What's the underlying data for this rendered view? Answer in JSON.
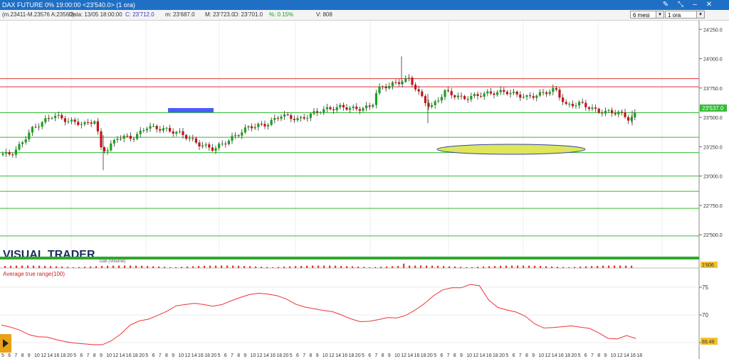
{
  "window": {
    "title": "DAX FUTURE 0% 19:00:00  <23'540.0> (1 ora)",
    "controls": [
      "pin-icon",
      "expand-icon",
      "minimize-icon",
      "close-icon"
    ]
  },
  "infobar": {
    "bidask": "(m.23411-M.23576 A:23560)",
    "data": "Data: 13/05 18:00:00",
    "close": "C: 23'712.0",
    "min": "m: 23'687.0",
    "max": "M: 23'723.0",
    "open": "O: 23'701.0",
    "pct": "%: 0.15%",
    "vol": "V: 808",
    "period": "6 mesi",
    "timeframe": "1 ora"
  },
  "price_axis": {
    "labels": [
      "24'250.0",
      "24'000.0",
      "23'750.0",
      "23'500.0",
      "23'250.0",
      "23'000.0",
      "22'750.0",
      "22'500.0"
    ],
    "current": "23'537.0"
  },
  "logo": "VISUAL TRADER",
  "volume_label": "Dati (Volume)",
  "volume_value": "1'606",
  "atr": {
    "label": "Average true range(100)",
    "labels": [
      "75",
      "70"
    ],
    "current": "65.49"
  },
  "colors": {
    "up": "#1aa31a",
    "down": "#cc1111",
    "support": "#33bb33",
    "resistance": "#dd3333",
    "atr_line": "#ee3333"
  },
  "chart_data": {
    "type": "candlestick",
    "ylim": [
      22350,
      24300
    ],
    "support_levels": [
      23540,
      23330,
      23200,
      23000,
      22870,
      22725,
      22490
    ],
    "resistance_levels": [
      23830,
      23760
    ],
    "atr_ylim": [
      62,
      80
    ],
    "atr_values": [
      67.9,
      67.4,
      66.7,
      65.6,
      65.1,
      65.0,
      64.4,
      63.9,
      63.6,
      63.4,
      63.2,
      63.2,
      64.2,
      65.8,
      67.9,
      68.9,
      69.3,
      70.2,
      71.2,
      72.5,
      72.8,
      73.1,
      72.8,
      72.4,
      72.8,
      73.7,
      74.5,
      75.2,
      75.5,
      75.3,
      74.9,
      74.1,
      72.9,
      72.2,
      71.8,
      71.4,
      71.1,
      70.3,
      69.4,
      68.7,
      68.8,
      69.2,
      69.7,
      69.6,
      70.2,
      71.5,
      73.0,
      74.9,
      76.3,
      76.8,
      76.8,
      77.6,
      77.3,
      73.9,
      72.1,
      71.5,
      71.0,
      70.0,
      68.2,
      67.2,
      67.3,
      67.5,
      67.7,
      67.4,
      67.1,
      66.0,
      64.7,
      64.6,
      65.4,
      64.7
    ],
    "x_labels": [
      "5",
      "6",
      "7",
      "8",
      "9",
      "10",
      "12",
      "14",
      "16",
      "18",
      "20"
    ]
  }
}
